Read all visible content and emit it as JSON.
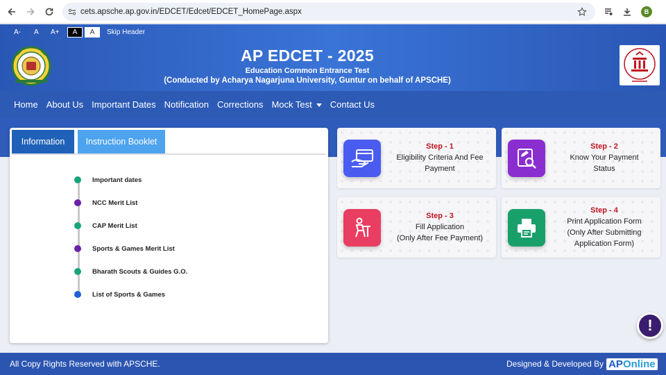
{
  "browser": {
    "url": "cets.apsche.ap.gov.in/EDCET/Edcet/EDCET_HomePage.aspx",
    "profile_initial": "B"
  },
  "accessibility": {
    "decrease": "A-",
    "normal": "A",
    "increase": "A+",
    "dark_theme": "A",
    "light_theme": "A",
    "skip_header": "Skip Header"
  },
  "header": {
    "title": "AP EDCET - 2025",
    "subtitle": "Education Common Entrance Test",
    "conducted_by": "(Conducted by Acharya Nagarjuna University, Guntur on behalf of APSCHE)"
  },
  "nav": {
    "items": [
      "Home",
      "About Us",
      "Important Dates",
      "Notification",
      "Corrections",
      "Mock Test",
      "Contact Us"
    ]
  },
  "tabs": {
    "information": "Information",
    "booklet": "Instruction Booklet"
  },
  "timeline": [
    {
      "label": "Important dates",
      "color": "#1aa37a"
    },
    {
      "label": "NCC Merit List",
      "color": "#6b21a8"
    },
    {
      "label": "CAP Merit List",
      "color": "#1aa37a"
    },
    {
      "label": "Sports & Games Merit List",
      "color": "#6b21a8"
    },
    {
      "label": "Bharath Scouts & Guides G.O.",
      "color": "#1aa37a"
    },
    {
      "label": "List of Sports & Games",
      "color": "#1f61d4"
    }
  ],
  "steps": [
    {
      "step": "Step - 1",
      "line1": "Eligibility Criteria And Fee",
      "line2": "Payment",
      "line3": ""
    },
    {
      "step": "Step - 2",
      "line1": "Know Your Payment",
      "line2": "Status",
      "line3": ""
    },
    {
      "step": "Step - 3",
      "line1": "Fill Application",
      "line2": "(Only After Fee Payment)",
      "line3": ""
    },
    {
      "step": "Step - 4",
      "line1": "Print Application Form",
      "line2": "(Only After Submitting",
      "line3": "Application Form)"
    }
  ],
  "colors": {
    "step1_icon": "#4a5cf0",
    "step2_icon": "#8a2ed0",
    "step3_icon": "#ea3d62",
    "step4_icon": "#19a06a"
  },
  "footer": {
    "copyright": "All Copy Rights Reserved with APSCHE.",
    "designed_by": "Designed & Developed By",
    "logo_ap": "AP",
    "logo_online": "Online"
  },
  "fab": {
    "symbol": "!"
  }
}
